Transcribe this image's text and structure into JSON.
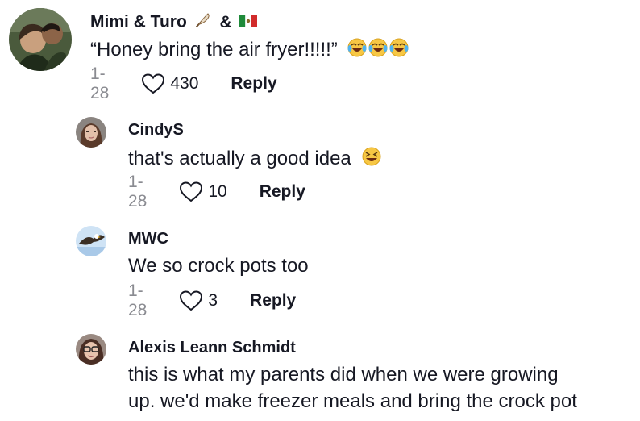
{
  "comments": [
    {
      "username": "Mimi & Turo",
      "username_sep": "&",
      "text": "“Honey bring the air fryer!!!!!”",
      "date": "1-28",
      "likes": "430",
      "reply_label": "Reply"
    },
    {
      "username": "CindyS",
      "text": "that's actually a good idea",
      "date": "1-28",
      "likes": "10",
      "reply_label": "Reply"
    },
    {
      "username": "MWC",
      "text": "We so crock pots too",
      "date": "1-28",
      "likes": "3",
      "reply_label": "Reply"
    },
    {
      "username": "Alexis Leann Schmidt",
      "text_line1": "this is what my parents did when we were growing",
      "text_line2": "up. we'd make freezer meals and bring the crock pot"
    }
  ],
  "icons": {
    "like": "heart-outline-icon",
    "emoji_laugh": "face-with-tears-of-joy-emoji",
    "emoji_grin": "grinning-squinting-face-emoji",
    "feather": "feather-icon",
    "flag": "mexico-flag-icon"
  },
  "colors": {
    "text": "#161823",
    "muted": "#8a8b91",
    "background": "#ffffff"
  }
}
